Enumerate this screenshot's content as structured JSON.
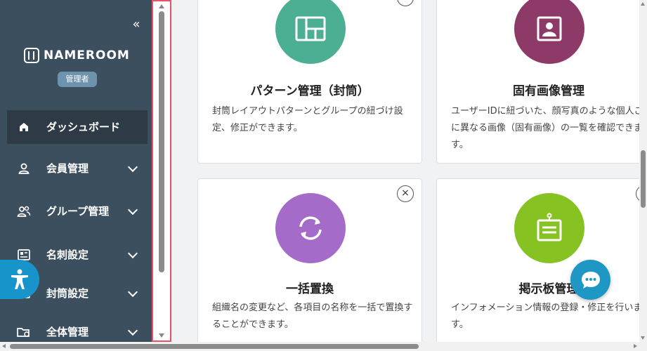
{
  "sidebar": {
    "collapse_glyph": "«",
    "logo_text": "NAMEROOM",
    "role_badge": "管理者",
    "items": [
      {
        "label": "ダッシュボード",
        "icon": "home-icon"
      },
      {
        "label": "会員管理",
        "icon": "user-icon"
      },
      {
        "label": "グループ管理",
        "icon": "group-icon"
      },
      {
        "label": "名刺設定",
        "icon": "business-card-icon"
      },
      {
        "label": "封筒設定",
        "icon": "envelope-icon"
      },
      {
        "label": "全体管理",
        "icon": "folder-settings-icon"
      }
    ]
  },
  "cards": [
    {
      "title": "パターン管理（封筒）",
      "description": "封筒レイアウトパターンとグループの紐づけ設定、修正ができます。",
      "icon": "layout-icon",
      "color": "#4caf93"
    },
    {
      "title": "固有画像管理",
      "description": "ユーザーIDに紐づいた、顔写真のような個人ごとに異なる画像（固有画像）の一覧を確認できます。",
      "icon": "portrait-icon",
      "color": "#8e3a68"
    },
    {
      "title": "一括置換",
      "description": "組織名の変更など、各項目の名称を一括で置換することができます。",
      "icon": "refresh-icon",
      "color": "#a56bc8"
    },
    {
      "title": "掲示板管理",
      "description": "インフォメーション情報の登録・修正を行います。",
      "icon": "notice-board-icon",
      "color": "#86c221"
    }
  ],
  "close_glyph": "×",
  "colors": {
    "sidebar_bg": "#3c4f5f",
    "active_bg": "#2e3b47",
    "accent": "#1f97c4",
    "highlight_border": "#e8536a"
  }
}
